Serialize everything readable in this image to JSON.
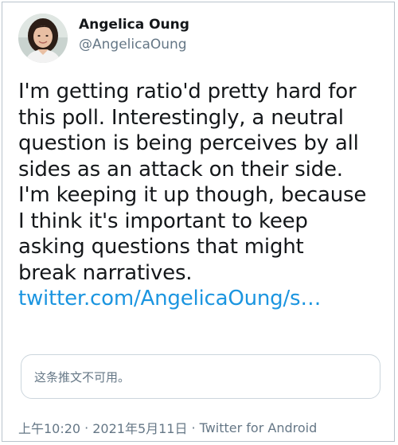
{
  "author": {
    "display_name": "Angelica Oung",
    "handle": "@AngelicaOung"
  },
  "tweet": {
    "text_lines": [
      "I'm getting ratio'd pretty hard for",
      "this poll. Interestingly, a neutral",
      "question is being perceives by all",
      "sides as an attack on their side.",
      "I'm keeping it up though, because",
      "I think it's important to keep",
      "asking questions that might",
      "break narratives."
    ],
    "link": "twitter.com/AngelicaOung/s…"
  },
  "quoted_tweet": {
    "text": "这条推文不可用。"
  },
  "meta": {
    "time": "上午10:20",
    "separator": "·",
    "date": "2021年5月11日",
    "source": "Twitter for Android"
  },
  "colors": {
    "link": "#1b95e0",
    "secondary_text": "#657786",
    "primary_text": "#14171a",
    "border": "#ccd6dd"
  },
  "icons": {
    "avatar": "profile-photo"
  }
}
